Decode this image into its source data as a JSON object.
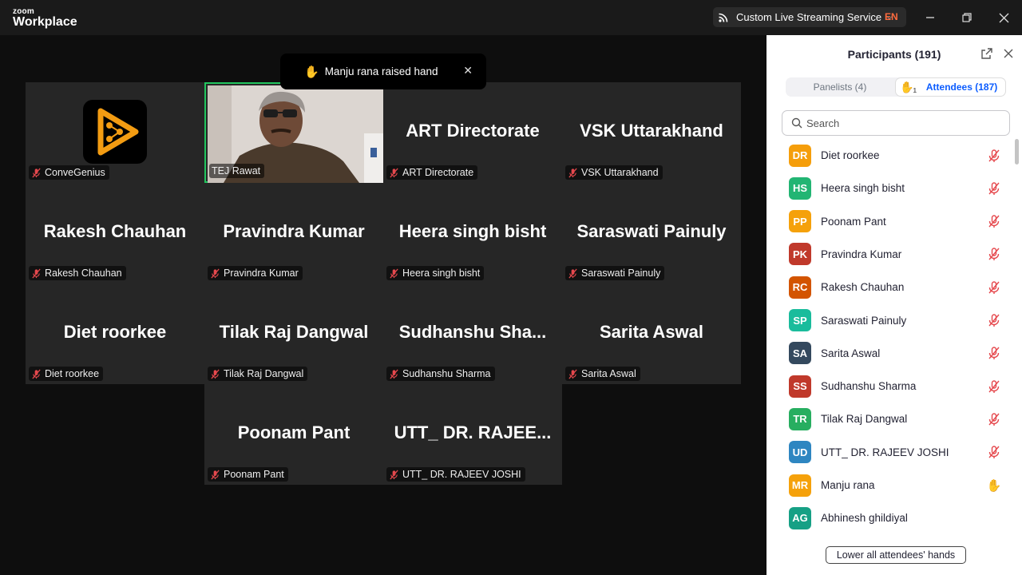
{
  "app": {
    "brand_small": "zoom",
    "brand_big": "Workplace"
  },
  "titlebar": {
    "stream_label": "Custom Live Streaming Service",
    "lang": "EN"
  },
  "toast": {
    "text": "Manju rana raised hand"
  },
  "tiles": [
    {
      "big": "",
      "tag": "ConveGenius",
      "kind": "logo"
    },
    {
      "big": "",
      "tag": "TEJ Rawat",
      "kind": "video"
    },
    {
      "big": "ART Directorate",
      "tag": "ART Directorate",
      "kind": "name"
    },
    {
      "big": "VSK Uttarakhand",
      "tag": "VSK Uttarakhand",
      "kind": "name"
    },
    {
      "big": "Rakesh Chauhan",
      "tag": "Rakesh Chauhan",
      "kind": "name"
    },
    {
      "big": "Pravindra Kumar",
      "tag": "Pravindra Kumar",
      "kind": "name"
    },
    {
      "big": "Heera singh bisht",
      "tag": "Heera singh bisht",
      "kind": "name"
    },
    {
      "big": "Saraswati Painuly",
      "tag": "Saraswati Painuly",
      "kind": "name"
    },
    {
      "big": "Diet roorkee",
      "tag": "Diet roorkee",
      "kind": "name"
    },
    {
      "big": "Tilak Raj Dangwal",
      "tag": "Tilak Raj Dangwal",
      "kind": "name"
    },
    {
      "big": "Sudhanshu  Sha...",
      "tag": "Sudhanshu Sharma",
      "kind": "name"
    },
    {
      "big": "Sarita Aswal",
      "tag": "Sarita Aswal",
      "kind": "name"
    },
    {
      "big": "Poonam Pant",
      "tag": "Poonam Pant",
      "kind": "name"
    },
    {
      "big": "UTT_ DR. RAJEE...",
      "tag": "UTT_ DR. RAJEEV JOSHI",
      "kind": "name"
    }
  ],
  "panel": {
    "title": "Participants (191)",
    "tab_panelists": "Panelists (4)",
    "tab_attendees": "Attendees (187)",
    "raised_count": "1",
    "search_placeholder": "Search",
    "lower_all": "Lower all attendees' hands",
    "participants": [
      {
        "initials": "DR",
        "name": "Diet roorkee",
        "color": "#f59e0b",
        "status": "muted"
      },
      {
        "initials": "HS",
        "name": "Heera singh bisht",
        "color": "#22b573",
        "status": "muted"
      },
      {
        "initials": "PP",
        "name": "Poonam Pant",
        "color": "#f5a10b",
        "status": "muted"
      },
      {
        "initials": "PK",
        "name": "Pravindra Kumar",
        "color": "#c0392b",
        "status": "muted"
      },
      {
        "initials": "RC",
        "name": "Rakesh Chauhan",
        "color": "#d35400",
        "status": "muted"
      },
      {
        "initials": "SP",
        "name": "Saraswati Painuly",
        "color": "#1abc9c",
        "status": "muted"
      },
      {
        "initials": "SA",
        "name": "Sarita Aswal",
        "color": "#34495e",
        "status": "muted"
      },
      {
        "initials": "SS",
        "name": "Sudhanshu Sharma",
        "color": "#c0392b",
        "status": "muted"
      },
      {
        "initials": "TR",
        "name": "Tilak Raj Dangwal",
        "color": "#27ae60",
        "status": "muted"
      },
      {
        "initials": "UD",
        "name": "UTT_ DR. RAJEEV JOSHI",
        "color": "#2e86c1",
        "status": "muted"
      },
      {
        "initials": "MR",
        "name": "Manju rana",
        "color": "#f5a10b",
        "status": "hand"
      },
      {
        "initials": "AG",
        "name": "Abhinesh ghildiyal",
        "color": "#16a085",
        "status": "none"
      }
    ]
  }
}
